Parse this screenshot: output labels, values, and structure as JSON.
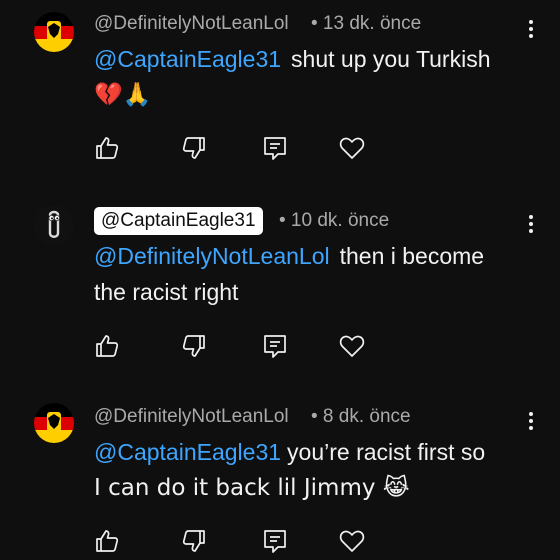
{
  "comments": [
    {
      "author": "@DefinitelyNotLeanLol",
      "time": "• 13 dk. önce",
      "mention": "@CaptainEagle31",
      "line1": "shut up you Turkish",
      "line2_emoji": "💔🙏",
      "avatar": "german-flag-eagle-avatar"
    },
    {
      "author": "@CaptainEagle31",
      "time": "• 10 dk. önce",
      "mention": "@DefinitelyNotLeanLol",
      "line1": "then i become",
      "line2": "the racist right",
      "avatar": "paperclip-avatar"
    },
    {
      "author": "@DefinitelyNotLeanLol",
      "time": "• 8 dk. önce",
      "mention": "@CaptainEagle31",
      "line1": "you’re racist first so",
      "line2": "I can do it back lil Jimmy 😹",
      "avatar": "german-flag-eagle-avatar"
    }
  ],
  "icons": {
    "like": "thumbs-up-icon",
    "dislike": "thumbs-down-icon",
    "reply": "reply-icon",
    "heart": "heart-icon",
    "more": "more-vert-icon"
  },
  "colors": {
    "background": "#0f0f0f",
    "mention": "#3ea6ff",
    "meta": "#aaaaaa",
    "text": "#f1f1f1"
  }
}
